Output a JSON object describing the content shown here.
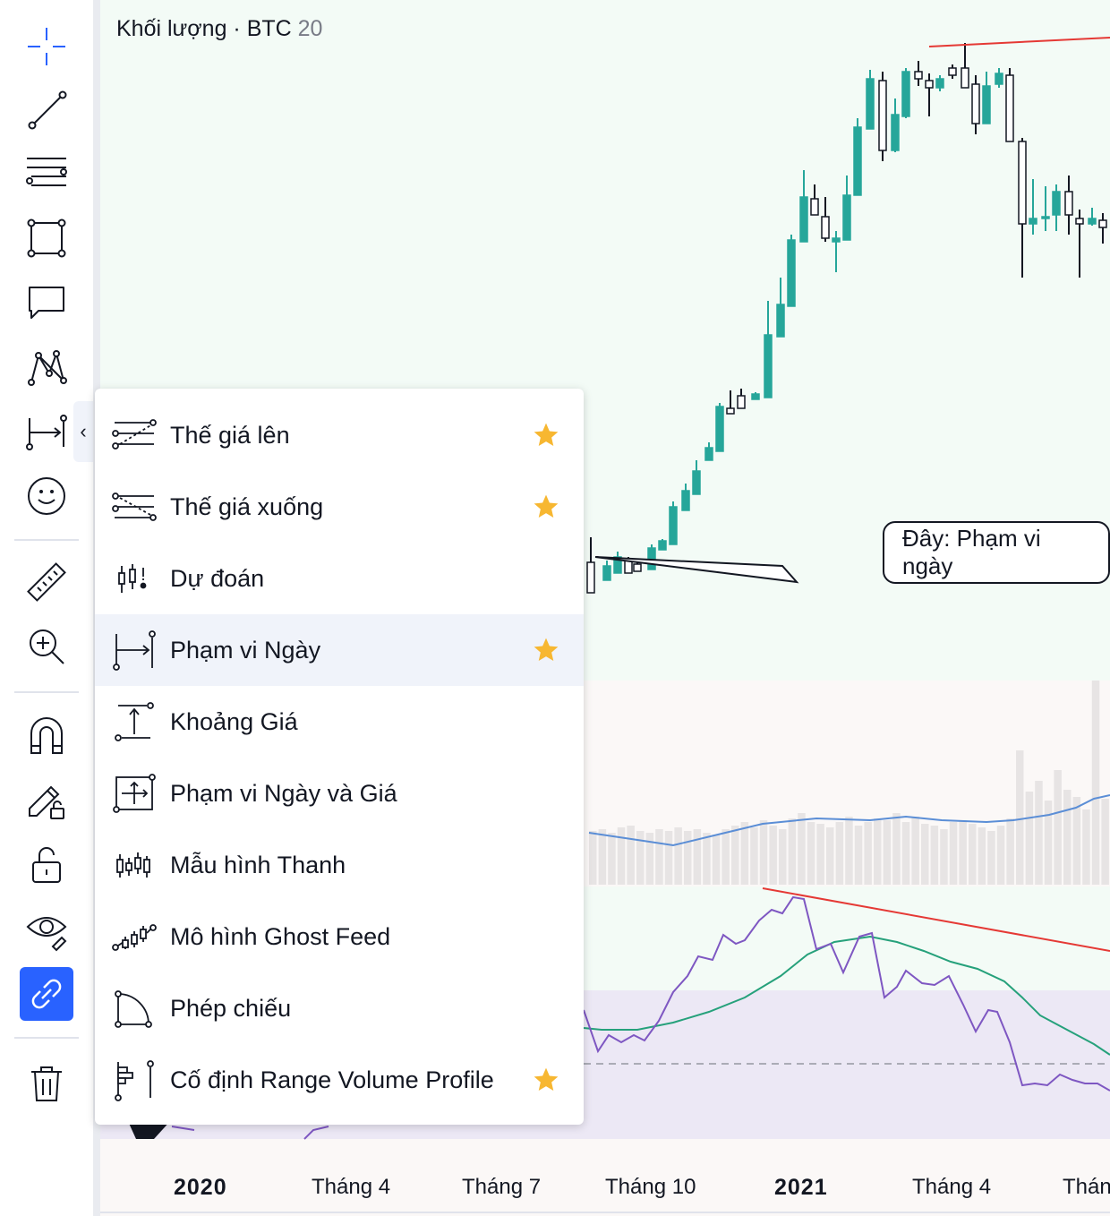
{
  "legend": {
    "title": "Khối lượng · BTC",
    "value": "20"
  },
  "time_axis": [
    "2020",
    "Tháng 4",
    "Tháng 7",
    "Tháng 10",
    "2021",
    "Tháng 4",
    "Thán"
  ],
  "callout": "Đây: Phạm vi ngày",
  "menu": {
    "items": [
      {
        "label": "Thế giá lên",
        "icon": "bull-trend-icon",
        "favorite": true
      },
      {
        "label": "Thế giá xuống",
        "icon": "bear-trend-icon",
        "favorite": true
      },
      {
        "label": "Dự đoán",
        "icon": "forecast-icon",
        "favorite": false
      },
      {
        "label": "Phạm vi Ngày",
        "icon": "date-range-icon",
        "favorite": true
      },
      {
        "label": "Khoảng Giá",
        "icon": "price-range-icon",
        "favorite": false
      },
      {
        "label": "Phạm vi Ngày và Giá",
        "icon": "date-price-range-icon",
        "favorite": false
      },
      {
        "label": "Mẫu hình Thanh",
        "icon": "bars-pattern-icon",
        "favorite": false
      },
      {
        "label": "Mô hình Ghost Feed",
        "icon": "ghost-feed-icon",
        "favorite": false
      },
      {
        "label": "Phép chiếu",
        "icon": "projection-icon",
        "favorite": false
      },
      {
        "label": "Cố định Range Volume Profile",
        "icon": "fixed-range-volume-profile-icon",
        "favorite": true
      }
    ],
    "hovered_item": "Phạm vi Ngày"
  },
  "toolbar": {
    "tools": [
      "crosshair-icon",
      "trend-line-icon",
      "fib-levels-icon",
      "rectangle-icon",
      "text-note-icon",
      "pattern-icon",
      "date-range-icon",
      "emoji-icon",
      "ruler-icon",
      "zoom-in-icon",
      "magnet-icon",
      "pencil-lock-icon",
      "lock-icon",
      "eye-icon",
      "link-icon",
      "trash-icon"
    ],
    "active_tool": "link-icon"
  },
  "colors": {
    "up_candle": "#26a69a",
    "accent": "#2962ff",
    "star": "#f7b731",
    "trendline": "#e53935",
    "rsi": "#7e57c2",
    "rsi_ma": "#26a17b",
    "volume_ma": "#5b8ed6"
  }
}
